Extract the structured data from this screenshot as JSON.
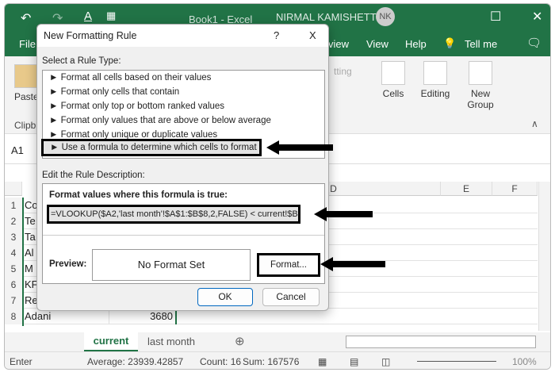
{
  "titlebar": {
    "title": "Book1 - Excel",
    "user": "NIRMAL KAMISHETTY",
    "initials": "NK"
  },
  "menu": {
    "file": "File",
    "review": "view",
    "view": "View",
    "help": "Help",
    "tellme": "Tell me"
  },
  "ribbon": {
    "paste": "Paste",
    "clipboard": "Clipb",
    "formatting": "tting",
    "cells": "Cells",
    "editing": "Editing",
    "new_group": "New Group"
  },
  "namebox": "A1",
  "columns": [
    "D",
    "E",
    "F"
  ],
  "rows": [
    {
      "n": "1",
      "a": "Co",
      "b": ""
    },
    {
      "n": "2",
      "a": "Te",
      "b": ""
    },
    {
      "n": "3",
      "a": "Ta",
      "b": ""
    },
    {
      "n": "4",
      "a": "Al",
      "b": ""
    },
    {
      "n": "5",
      "a": "M",
      "b": ""
    },
    {
      "n": "6",
      "a": "KF",
      "b": ""
    },
    {
      "n": "7",
      "a": "Re",
      "b": ""
    },
    {
      "n": "8",
      "a": "Adani",
      "b": "3680"
    }
  ],
  "sheets": {
    "current": "current",
    "last": "last month"
  },
  "status": {
    "mode": "Enter",
    "average": "Average: 23939.42857",
    "count": "Count: 16",
    "sum": "Sum: 167576",
    "zoom": "100%"
  },
  "dialog": {
    "title": "New Formatting Rule",
    "help": "?",
    "close": "X",
    "select_label": "Select a Rule Type:",
    "rule_types": [
      "Format all cells based on their values",
      "Format only cells that contain",
      "Format only top or bottom ranked values",
      "Format only values that are above or below average",
      "Format only unique or duplicate values",
      "Use a formula to determine which cells to format"
    ],
    "edit_label": "Edit the Rule Description:",
    "formula_label": "Format values where this formula is true:",
    "formula": "=VLOOKUP($A2,'last month'!$A$1:$B$8,2,FALSE) < current!$B",
    "preview_label": "Preview:",
    "preview_text": "No Format Set",
    "format_btn": "Format...",
    "ok": "OK",
    "cancel": "Cancel"
  }
}
